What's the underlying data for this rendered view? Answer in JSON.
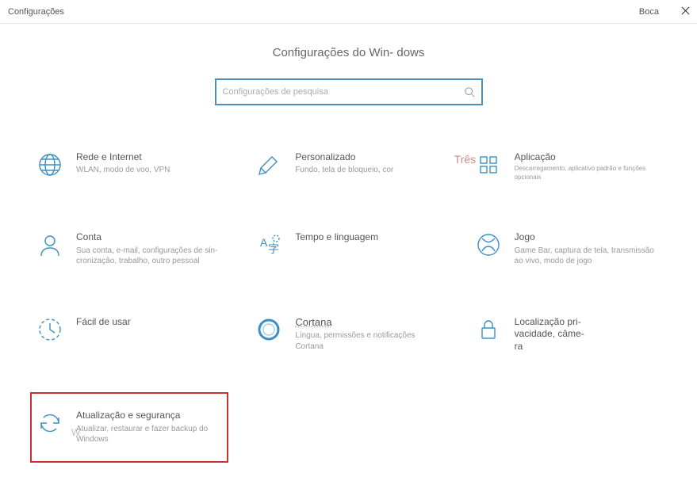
{
  "titlebar": {
    "title": "Configurações",
    "user": "Boca"
  },
  "hero": {
    "heading": "Configurações do Win-\ndows"
  },
  "search": {
    "placeholder": "Configurações de pesquisa"
  },
  "tiles": {
    "network": {
      "title": "Rede e Internet",
      "desc": "WLAN, modo de voo, VPN"
    },
    "personal": {
      "title": "Personalizado",
      "desc": "Fundo, tela de bloqueio, cor"
    },
    "apps": {
      "title": "Aplicação",
      "desc": "Descarregamento, aplicativo padrão e funções opcionais",
      "badge": "Três"
    },
    "account": {
      "title": "Conta",
      "desc": "Sua conta, e-mail, configurações de sin-\ncronização, trabalho, outro pessoal"
    },
    "timelang": {
      "title": "Tempo e linguagem",
      "desc": ""
    },
    "gaming": {
      "title": "Jogo",
      "desc": "Game Bar, captura de tela, transmissão ao vivo, modo de jogo"
    },
    "ease": {
      "title": "Fácil de usar",
      "desc": ""
    },
    "cortana": {
      "title": "Cortana",
      "desc": "Língua, permissões e notificações Cortana"
    },
    "privacy": {
      "title": "Localização pri-\nvacidade, câme-\nra",
      "desc": ""
    },
    "update": {
      "title": "Atualização e segurança",
      "desc": "Atualizar, restaurar e fazer backup do Windows",
      "badge": "W"
    }
  }
}
